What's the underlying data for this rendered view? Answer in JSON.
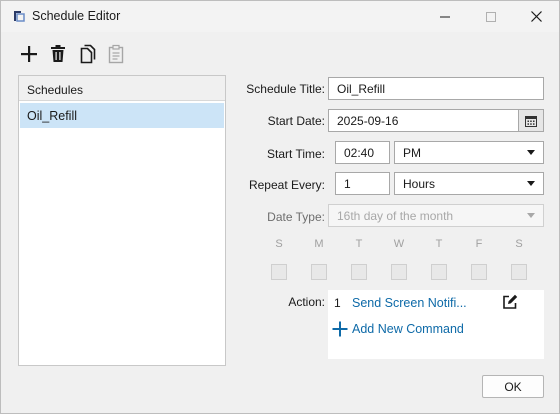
{
  "window": {
    "title": "Schedule Editor",
    "accent_color": "#0e6aa8",
    "selection_color": "#cce4f7"
  },
  "toolbar": {
    "add_icon": "plus-icon",
    "delete_icon": "trash-icon",
    "copy_icon": "copy-icon",
    "paste_icon": "clipboard-icon"
  },
  "schedules": {
    "header": "Schedules",
    "items": [
      {
        "label": "Oil_Refill",
        "selected": true
      }
    ]
  },
  "form": {
    "schedule_title": {
      "label": "Schedule Title:",
      "value": "Oil_Refill"
    },
    "start_date": {
      "label": "Start Date:",
      "value": "2025-09-16"
    },
    "start_time": {
      "label": "Start Time:",
      "value": "02:40",
      "ampm": "PM"
    },
    "repeat_every": {
      "label": "Repeat Every:",
      "value": "1",
      "unit": "Hours"
    },
    "date_type": {
      "label": "Date Type:",
      "value": "16th day of the month",
      "disabled": true
    },
    "days": [
      "S",
      "M",
      "T",
      "W",
      "T",
      "F",
      "S"
    ],
    "action": {
      "label": "Action:",
      "commands": [
        {
          "number": "1",
          "text": "Send Screen Notifi..."
        }
      ],
      "add_label": "Add New Command"
    }
  },
  "footer": {
    "ok_label": "OK"
  }
}
